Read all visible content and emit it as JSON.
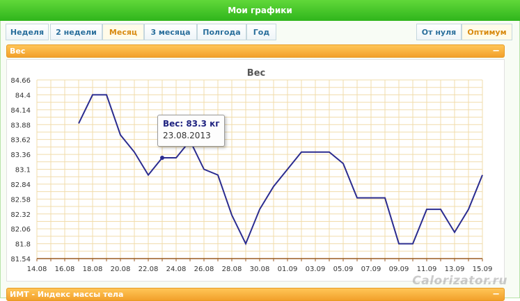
{
  "header": {
    "title": "Мои графики"
  },
  "period_tabs": [
    {
      "label": "Неделя",
      "active": false
    },
    {
      "label": "2 недели",
      "active": false
    },
    {
      "label": "Месяц",
      "active": true
    },
    {
      "label": "3 месяца",
      "active": false
    },
    {
      "label": "Полгода",
      "active": false
    },
    {
      "label": "Год",
      "active": false
    }
  ],
  "scale_tabs": [
    {
      "label": "От нуля",
      "active": false
    },
    {
      "label": "Оптимум",
      "active": true
    }
  ],
  "panels": {
    "weight": {
      "title": "Вес",
      "collapse_label": "−"
    },
    "bmi": {
      "title": "ИМТ - Индекс массы тела",
      "collapse_label": "−"
    }
  },
  "tooltip": {
    "label": "Вес: 83.3 кг",
    "date": "23.08.2013"
  },
  "watermark": "Calorizator.ru",
  "colors": {
    "line": "#2b2c8f",
    "grid": "#f1dcab",
    "accent": "#f2a02b",
    "brand_green": "#3fc224"
  },
  "chart_data": {
    "type": "line",
    "title": "Вес",
    "xlabel": "",
    "ylabel": "",
    "xlim": [
      "14.08",
      "15.09"
    ],
    "ylim": [
      81.54,
      84.66
    ],
    "x_tick_labels": [
      "14.08",
      "16.08",
      "18.08",
      "20.08",
      "22.08",
      "24.08",
      "26.08",
      "28.08",
      "30.08",
      "01.09",
      "03.09",
      "05.09",
      "07.09",
      "09.09",
      "11.09",
      "13.09",
      "15.09"
    ],
    "y_tick_labels": [
      "84.66",
      "84.4",
      "84.14",
      "83.88",
      "83.62",
      "83.36",
      "83.1",
      "82.84",
      "82.58",
      "82.32",
      "82.06",
      "81.8",
      "81.54"
    ],
    "series": [
      {
        "x": [
          "17.08",
          "18.08",
          "19.08",
          "20.08",
          "21.08",
          "22.08",
          "23.08",
          "24.08",
          "25.08",
          "26.08",
          "27.08",
          "28.08",
          "29.08",
          "30.08",
          "31.08",
          "01.09",
          "02.09",
          "03.09",
          "04.09",
          "05.09",
          "06.09",
          "07.09",
          "08.09",
          "09.09",
          "10.09",
          "11.09",
          "12.09",
          "13.09",
          "14.09",
          "15.09"
        ],
        "values": [
          83.9,
          84.4,
          84.4,
          83.7,
          83.4,
          83.0,
          83.3,
          83.3,
          83.6,
          83.1,
          83.0,
          82.3,
          81.8,
          82.4,
          82.8,
          83.1,
          83.4,
          83.4,
          83.4,
          83.2,
          82.6,
          82.6,
          82.6,
          81.8,
          81.8,
          82.4,
          82.4,
          82.0,
          82.4,
          83.0
        ]
      }
    ],
    "highlight": {
      "x": "23.08",
      "value": 83.3
    },
    "grid": true,
    "legend": "none"
  }
}
